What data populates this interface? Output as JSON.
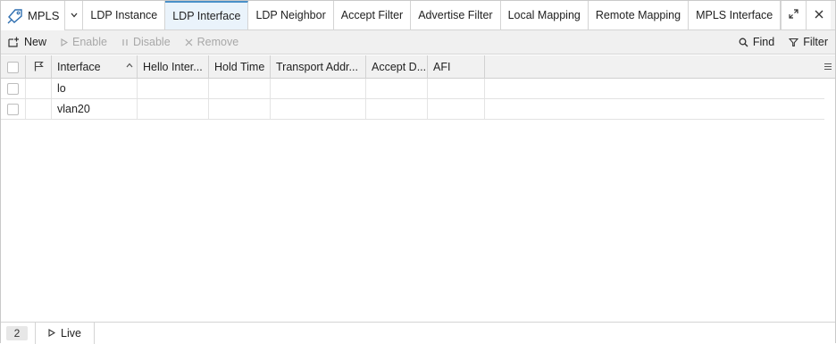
{
  "app": {
    "title": "MPLS",
    "icon": "tag-icon"
  },
  "tabs": [
    {
      "label": "LDP Instance",
      "active": false
    },
    {
      "label": "LDP Interface",
      "active": true
    },
    {
      "label": "LDP Neighbor",
      "active": false
    },
    {
      "label": "Accept Filter",
      "active": false
    },
    {
      "label": "Advertise Filter",
      "active": false
    },
    {
      "label": "Local Mapping",
      "active": false
    },
    {
      "label": "Remote Mapping",
      "active": false
    },
    {
      "label": "MPLS Interface",
      "active": false
    }
  ],
  "toolbar": {
    "new_label": "New",
    "enable_label": "Enable",
    "disable_label": "Disable",
    "remove_label": "Remove",
    "find_label": "Find",
    "filter_label": "Filter"
  },
  "table": {
    "columns": [
      "Interface",
      "Hello Inter...",
      "Hold Time",
      "Transport Addr...",
      "Accept D...",
      "AFI"
    ],
    "sorted_column": "Interface",
    "rows": [
      {
        "interface": "lo",
        "hello_interval": "",
        "hold_time": "",
        "transport_address": "",
        "accept_dynamic": "",
        "afi": ""
      },
      {
        "interface": "vlan20",
        "hello_interval": "",
        "hold_time": "",
        "transport_address": "",
        "accept_dynamic": "",
        "afi": ""
      }
    ]
  },
  "status": {
    "count": "2",
    "live_label": "Live"
  },
  "colors": {
    "active_tab_accent": "#4a90c8",
    "disabled_text": "#a8a8a8"
  }
}
